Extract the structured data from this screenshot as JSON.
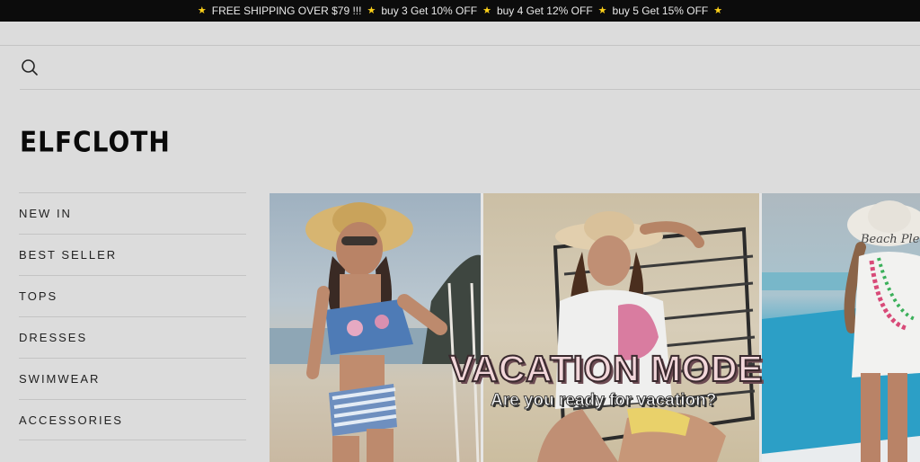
{
  "announcement": {
    "segments": [
      "FREE SHIPPING OVER $79 !!!",
      "buy 3 Get 10% OFF",
      "buy 4 Get 12% OFF",
      "buy 5 Get 15% OFF"
    ],
    "star_color": "#ffd21a"
  },
  "header": {
    "search_icon": "search-icon",
    "logo_text": "ELFCLOTH"
  },
  "nav": {
    "items": [
      {
        "label": "NEW IN"
      },
      {
        "label": "BEST SELLER"
      },
      {
        "label": "TOPS"
      },
      {
        "label": "DRESSES"
      },
      {
        "label": "SWIMWEAR"
      },
      {
        "label": "ACCESSORIES"
      }
    ]
  },
  "hero": {
    "title": "VACATION MODE",
    "subtitle": "Are you ready for vacation?",
    "hat_text": "Beach Plea"
  },
  "colors": {
    "announcement_bg": "#0c0c0c",
    "page_bg": "#dcdcdc"
  }
}
